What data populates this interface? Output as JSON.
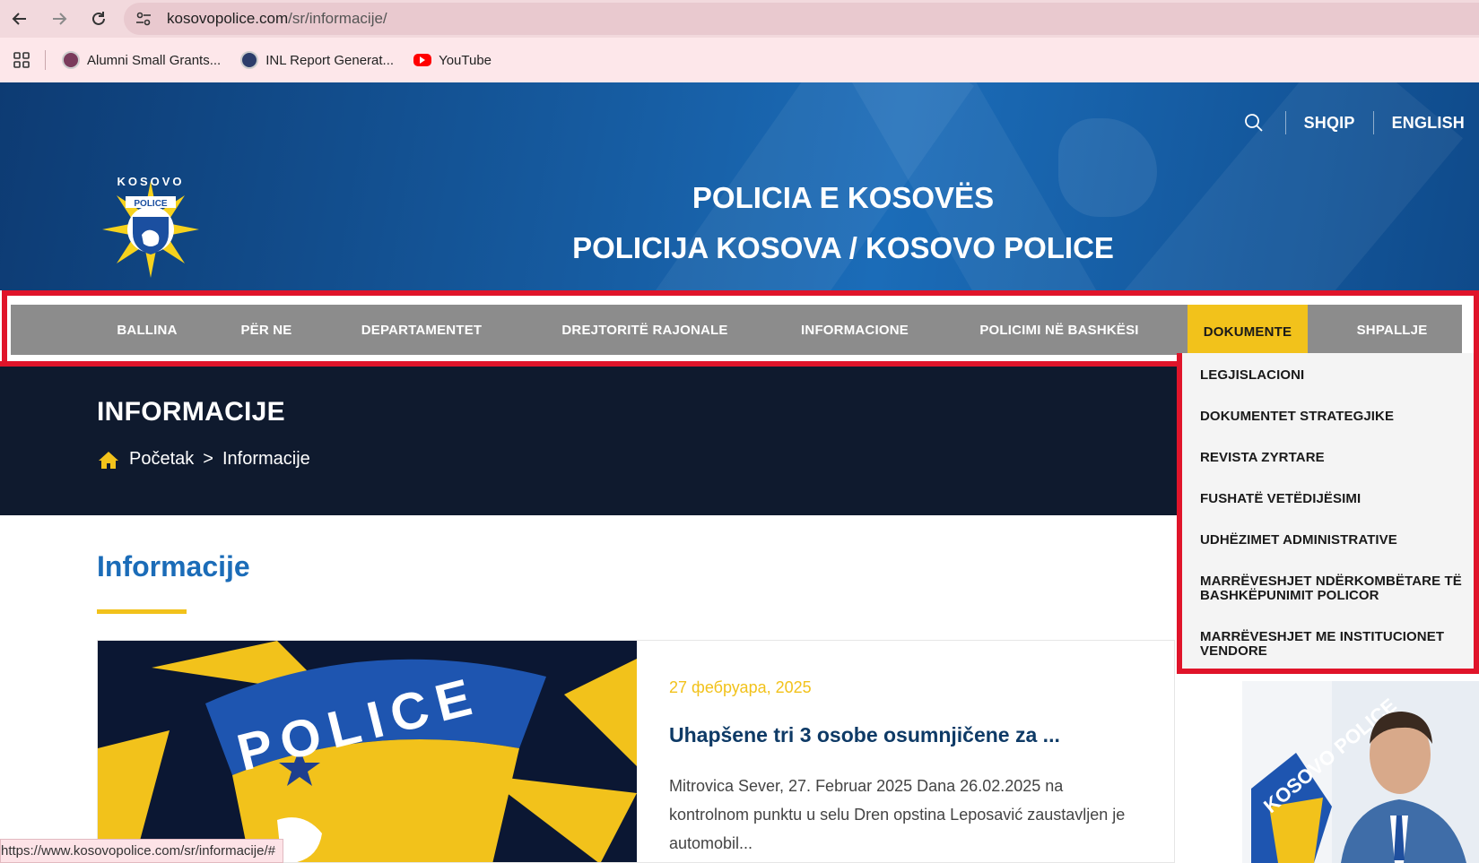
{
  "browser": {
    "url_domain": "kosovopolice.com",
    "url_path": "/sr/informacije/",
    "bookmarks": [
      {
        "label": "Alumni Small Grants..."
      },
      {
        "label": "INL Report Generat..."
      },
      {
        "label": "YouTube"
      }
    ],
    "status_url": "https://www.kosovopolice.com/sr/informacije/#"
  },
  "header": {
    "lang_sq": "SHQIP",
    "lang_en": "ENGLISH",
    "title_line1": "POLICIA E KOSOVËS",
    "title_line2": "POLICIJA KOSOVA / KOSOVO POLICE",
    "logo_top_text": "KOSOVO",
    "logo_badge_text": "POLICE"
  },
  "nav": {
    "items": [
      {
        "label": "BALLINA"
      },
      {
        "label": "PËR NE"
      },
      {
        "label": "DEPARTAMENTET"
      },
      {
        "label": "DREJTORITË RAJONALE"
      },
      {
        "label": "INFORMACIONE"
      },
      {
        "label": "POLICIMI NË BASHKËSI"
      },
      {
        "label": "DOKUMENTE"
      },
      {
        "label": "SHPALLJE"
      }
    ],
    "active": "DOKUMENTE"
  },
  "dropdown": {
    "items": [
      {
        "label": "LEGJISLACIONI"
      },
      {
        "label": "DOKUMENTET STRATEGJIKE"
      },
      {
        "label": "REVISTA ZYRTARE"
      },
      {
        "label": "FUSHATË VETËDIJËSIMI"
      },
      {
        "label": "UDHËZIMET ADMINISTRATIVE"
      },
      {
        "label": "MARRËVESHJET NDËRKOMBËTARE TË BASHKËPUNIMIT POLICOR"
      },
      {
        "label": "MARRËVESHJET ME INSTITUCIONET VENDORE"
      }
    ]
  },
  "banner": {
    "heading": "INFORMACIJE",
    "breadcrumb_home": "Početak",
    "breadcrumb_sep": ">",
    "breadcrumb_current": "Informacije"
  },
  "content": {
    "section_title": "Informacije",
    "news": {
      "image_text": "POLICE",
      "date": "27 фебруара, 2025",
      "title": "Uhapšene tri 3 osobe osumnjičene za ...",
      "excerpt": "Mitrovica Sever, 27. Februar 2025 Dana 26.02.2025 na kontrolnom punktu u selu Dren opstina Leposavić zaustavljen je automobil..."
    },
    "side_photo_text": "KOSOVO POLICE"
  },
  "colors": {
    "brand_blue": "#1b6cb8",
    "accent_yellow": "#f2c21b",
    "nav_gray": "#8c8c8c",
    "banner_dark": "#0f1a2e",
    "highlight_red": "#e0142a"
  }
}
